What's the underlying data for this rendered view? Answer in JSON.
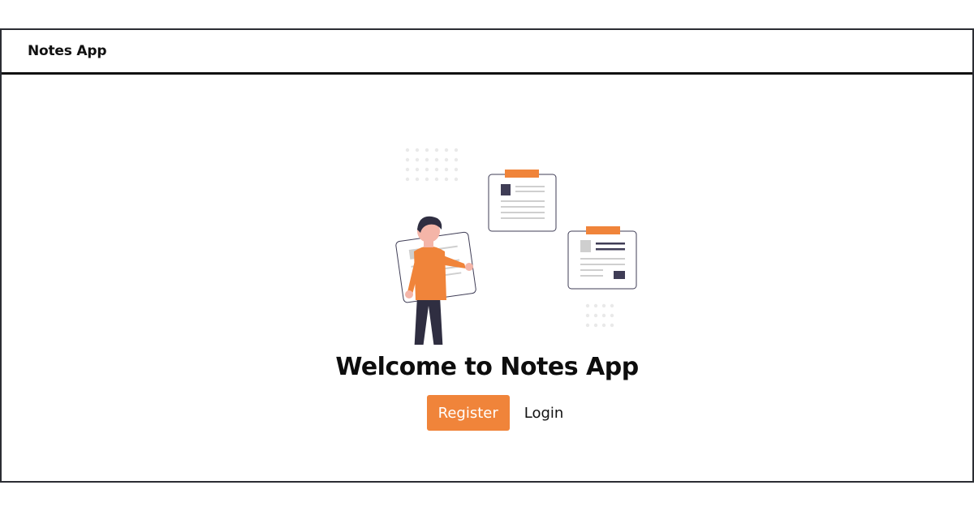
{
  "header": {
    "brand": "Notes App"
  },
  "hero": {
    "title": "Welcome to Notes App",
    "register_label": "Register",
    "login_label": "Login"
  },
  "colors": {
    "accent": "#f0843a",
    "dark": "#2f2e41",
    "border": "#111111"
  },
  "icons": {
    "hero": "notes-illustration-icon"
  }
}
